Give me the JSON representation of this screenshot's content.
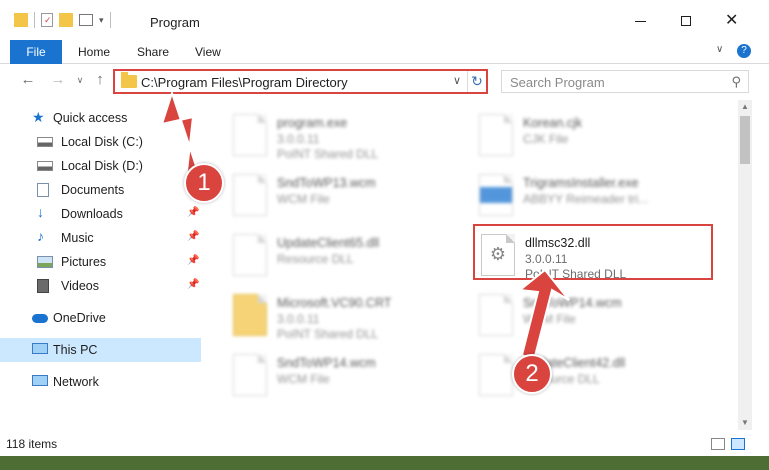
{
  "window": {
    "title": "Program"
  },
  "ribbon": {
    "tabs": [
      "File",
      "Home",
      "Share",
      "View"
    ]
  },
  "address": {
    "path": "C:\\Program Files\\Program Directory"
  },
  "search": {
    "placeholder": "Search Program"
  },
  "nav": {
    "quick_access": "Quick access",
    "items": [
      {
        "label": "Local Disk (C:)"
      },
      {
        "label": "Local Disk (D:)"
      },
      {
        "label": "Documents"
      },
      {
        "label": "Downloads"
      },
      {
        "label": "Music"
      },
      {
        "label": "Pictures"
      },
      {
        "label": "Videos"
      }
    ],
    "onedrive": "OneDrive",
    "this_pc": "This PC",
    "network": "Network"
  },
  "files": [
    {
      "name": "program.exe",
      "line2": "3.0.0.11",
      "line3": "PoINT Shared DLL"
    },
    {
      "name": "Korean.cjk",
      "line2": "CJK File",
      "line3": ""
    },
    {
      "name": "SndToWP13.wcm",
      "line2": "WCM File",
      "line3": ""
    },
    {
      "name": "TrigramsInstaller.exe",
      "line2": "ABBYY Reimeader tri...",
      "line3": ""
    },
    {
      "name": "UpdateClient65.dll",
      "line2": "Resource DLL",
      "line3": ""
    },
    {
      "name": "dllmsc32.dll",
      "line2": "3.0.0.11",
      "line3": "PoINT Shared DLL"
    },
    {
      "name": "Microsoft.VC90.CRT",
      "line2": "3.0.0.11",
      "line3": "PoINT Shared DLL"
    },
    {
      "name": "SndToWP14.wcm",
      "line2": "WCM File",
      "line3": ""
    },
    {
      "name": "SndToWP14.wcm",
      "line2": "WCM File",
      "line3": ""
    },
    {
      "name": "UpdateClient42.dll",
      "line2": "Resource DLL",
      "line3": ""
    }
  ],
  "status": {
    "item_count": "118 items"
  },
  "callouts": [
    "1",
    "2"
  ],
  "colors": {
    "accent": "#1a74cf",
    "highlight": "#d9443f",
    "selected": "#cce8ff",
    "folder": "#f3c549"
  }
}
